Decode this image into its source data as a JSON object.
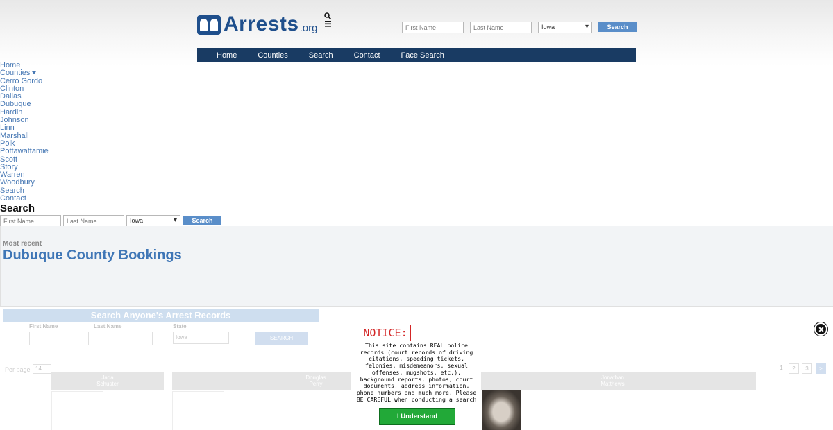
{
  "header": {
    "logo_text": "Arrests",
    "logo_tld": ".org",
    "search_icon": "search-icon",
    "menu_icon": "hamburger-menu-icon",
    "first_name_placeholder": "First Name",
    "last_name_placeholder": "Last Name",
    "state_value": "Iowa",
    "search_label": "Search"
  },
  "nav": [
    "Home",
    "Counties",
    "Search",
    "Contact",
    "Face Search"
  ],
  "sidebar": {
    "items": [
      "Home",
      "Counties",
      "Cerro Gordo",
      "Clinton",
      "Dallas",
      "Dubuque",
      "Hardin",
      "Johnson",
      "Linn",
      "Marshall",
      "Polk",
      "Pottawattamie",
      "Scott",
      "Story",
      "Warren",
      "Woodbury",
      "Search",
      "Contact"
    ]
  },
  "search_section": {
    "heading": "Search",
    "first_name_placeholder": "First Name",
    "last_name_placeholder": "Last Name",
    "state_value": "Iowa",
    "button": "Search"
  },
  "bookings": {
    "subtitle": "Most recent",
    "title": "Dubuque County Bookings"
  },
  "promo": {
    "title": "Search Anyone's Arrest Records",
    "first_label": "First Name",
    "last_label": "Last Name",
    "state_label": "State",
    "state_value": "Iowa",
    "button": "SEARCH"
  },
  "listing": {
    "per_page_label": "Per page",
    "per_page_value": "14",
    "pages": [
      "1",
      "2",
      "3",
      ">"
    ],
    "cards": [
      {
        "first": "Jada",
        "last": "Schuster"
      },
      {
        "first": "Douglas",
        "last": "Perry"
      },
      {
        "first": "Jonathan",
        "last": "Matthews"
      }
    ]
  },
  "notice": {
    "title": "NOTICE:",
    "body": "This site contains REAL police records (court records of driving citations, speeding tickets, felonies, misdemeanors, sexual offenses, mugshots, etc.), background reports, photos, court documents, address information, phone numbers and much more. Please BE CAREFUL when conducting a search",
    "button": "I Understand"
  },
  "colors": {
    "brand": "#1f4f8c",
    "nav_bg": "#193b63",
    "button_blue": "#5a8ec9",
    "link": "#4778b4",
    "notice_red": "#d32626",
    "ok_green": "#22a938"
  }
}
